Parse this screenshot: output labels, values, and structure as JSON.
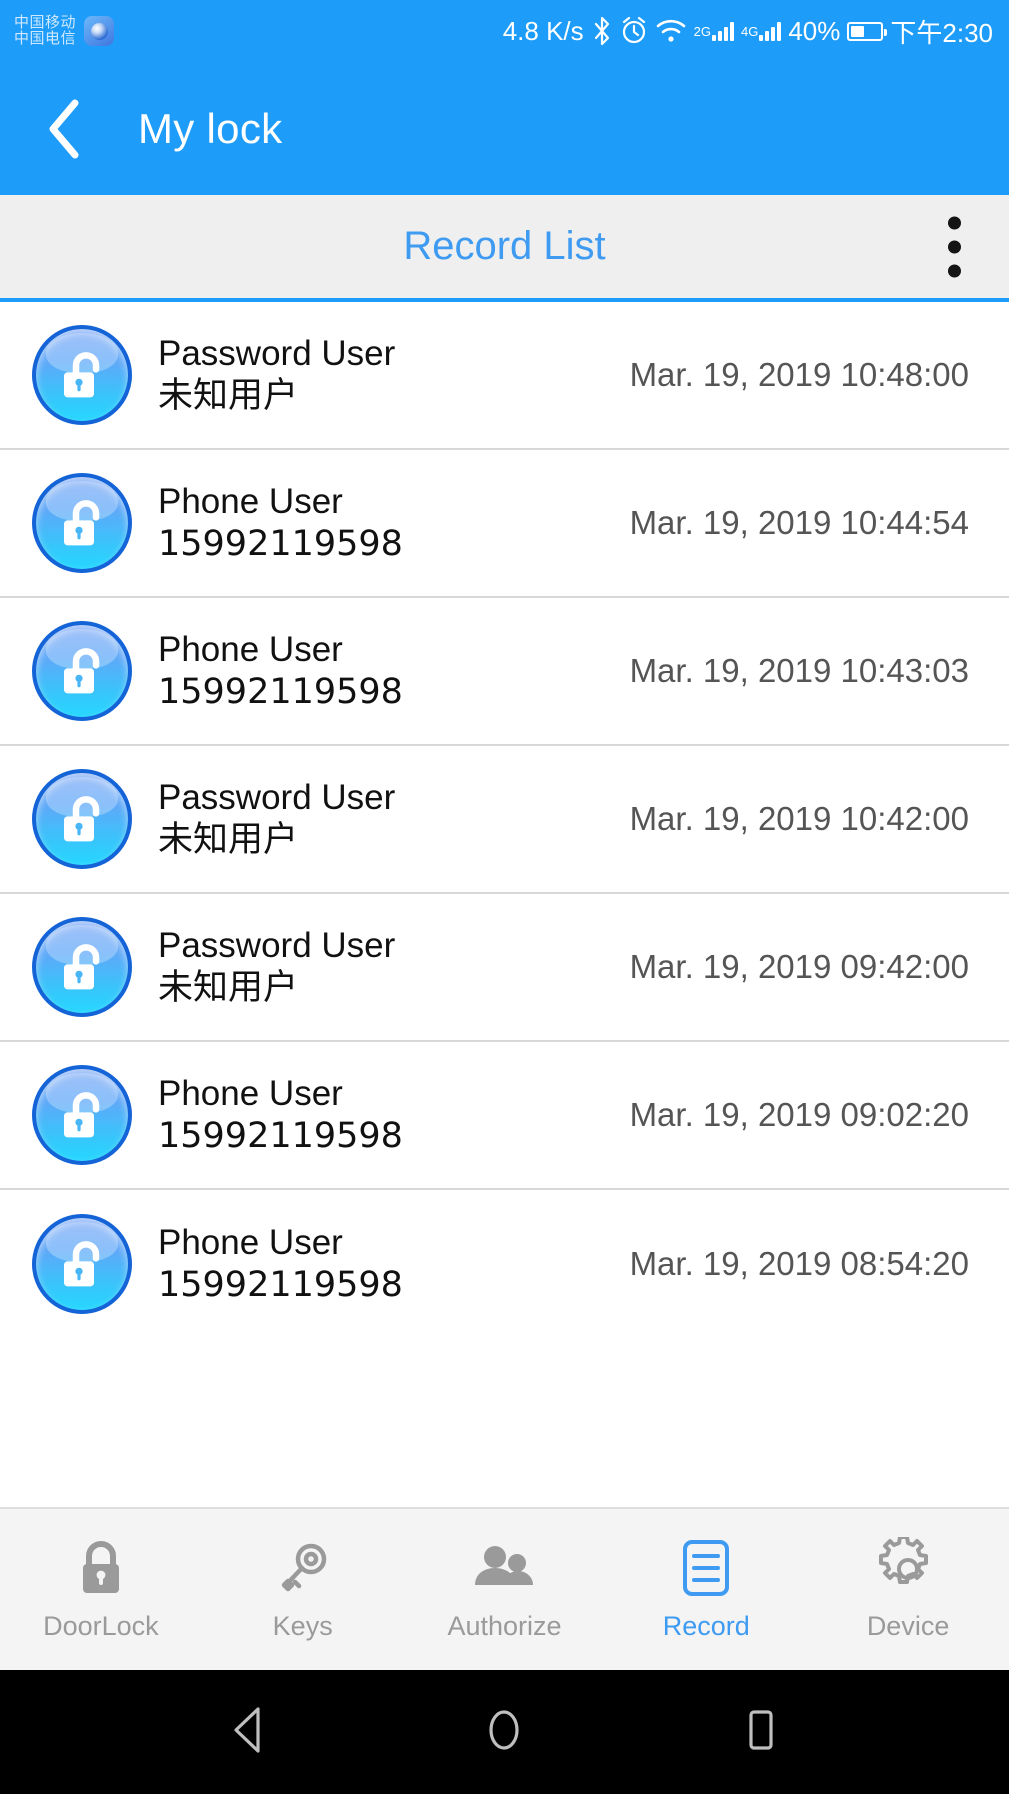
{
  "status_bar": {
    "carrier_primary": "中国移动",
    "carrier_secondary": "中国电信",
    "app_badge_icon": "app-badge-icon",
    "network_speed": "4.8 K/s",
    "bluetooth_icon": "bluetooth-icon",
    "alarm_icon": "alarm-clock-icon",
    "wifi_icon": "wifi-icon",
    "sim1_label": "2G",
    "sim2_label": "4G",
    "battery_percent": "40%",
    "battery_level": 40,
    "clock": "下午2:30"
  },
  "app_bar": {
    "back_icon": "back-chevron-icon",
    "title": "My lock"
  },
  "tab_header": {
    "title": "Record List",
    "overflow_icon": "overflow-menu-icon",
    "accent_color": "#3E9BF1"
  },
  "records": [
    {
      "type": "Password User",
      "identity": "未知用户",
      "timestamp": "Mar. 19, 2019 10:48:00",
      "icon": "unlocked-padlock-icon"
    },
    {
      "type": "Phone User",
      "identity": "15992119598",
      "timestamp": "Mar. 19, 2019 10:44:54",
      "icon": "unlocked-padlock-icon"
    },
    {
      "type": "Phone User",
      "identity": "15992119598",
      "timestamp": "Mar. 19, 2019 10:43:03",
      "icon": "unlocked-padlock-icon"
    },
    {
      "type": "Password User",
      "identity": "未知用户",
      "timestamp": "Mar. 19, 2019 10:42:00",
      "icon": "unlocked-padlock-icon"
    },
    {
      "type": "Password User",
      "identity": "未知用户",
      "timestamp": "Mar. 19, 2019 09:42:00",
      "icon": "unlocked-padlock-icon"
    },
    {
      "type": "Phone User",
      "identity": "15992119598",
      "timestamp": "Mar. 19, 2019 09:02:20",
      "icon": "unlocked-padlock-icon"
    },
    {
      "type": "Phone User",
      "identity": "15992119598",
      "timestamp": "Mar. 19, 2019 08:54:20",
      "icon": "unlocked-padlock-icon"
    }
  ],
  "bottom_nav": {
    "items": [
      {
        "label": "DoorLock",
        "icon": "padlock-icon",
        "active": false
      },
      {
        "label": "Keys",
        "icon": "key-icon",
        "active": false
      },
      {
        "label": "Authorize",
        "icon": "people-icon",
        "active": false
      },
      {
        "label": "Record",
        "icon": "document-list-icon",
        "active": true
      },
      {
        "label": "Device",
        "icon": "gear-icon",
        "active": false
      }
    ],
    "active_color": "#3E9BF1",
    "inactive_color": "#9A9A9A"
  },
  "system_nav": {
    "back_icon": "system-back-icon",
    "home_icon": "system-home-icon",
    "recents_icon": "system-recents-icon"
  }
}
